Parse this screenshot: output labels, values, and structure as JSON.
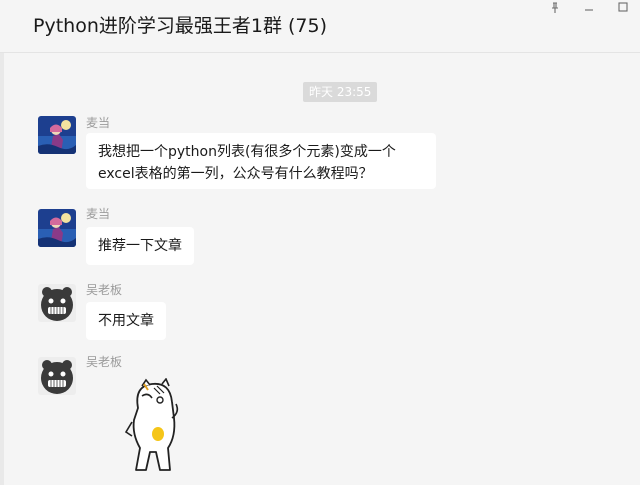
{
  "window": {
    "title": "Python进阶学习最强王者1群 (75)",
    "controls": {
      "pin_icon": "pin-icon",
      "minimize_icon": "minimize-icon",
      "maximize_icon": "maximize-icon"
    }
  },
  "chat": {
    "timestamp": "昨天 23:55",
    "messages": [
      {
        "sender": "麦当",
        "avatar": "anime-night-avatar",
        "text_lines": [
          "我想把一个python列表(有很多个元素)变成一个",
          "excel表格的第一列，公众号有什么教程吗？"
        ]
      },
      {
        "sender": "麦当",
        "avatar": "anime-night-avatar",
        "text_lines": [
          "推荐一下文章"
        ]
      },
      {
        "sender": "吴老板",
        "avatar": "grinning-face-avatar",
        "text_lines": [
          "不用文章"
        ]
      },
      {
        "sender": "吴老板",
        "avatar": "grinning-face-avatar",
        "sticker": "cartoon-cat-sticker"
      }
    ]
  },
  "colors": {
    "background": "#f5f5f5",
    "bubble": "#ffffff",
    "timestamp_bg": "#dadada",
    "sender_name": "#9b9b9b"
  }
}
